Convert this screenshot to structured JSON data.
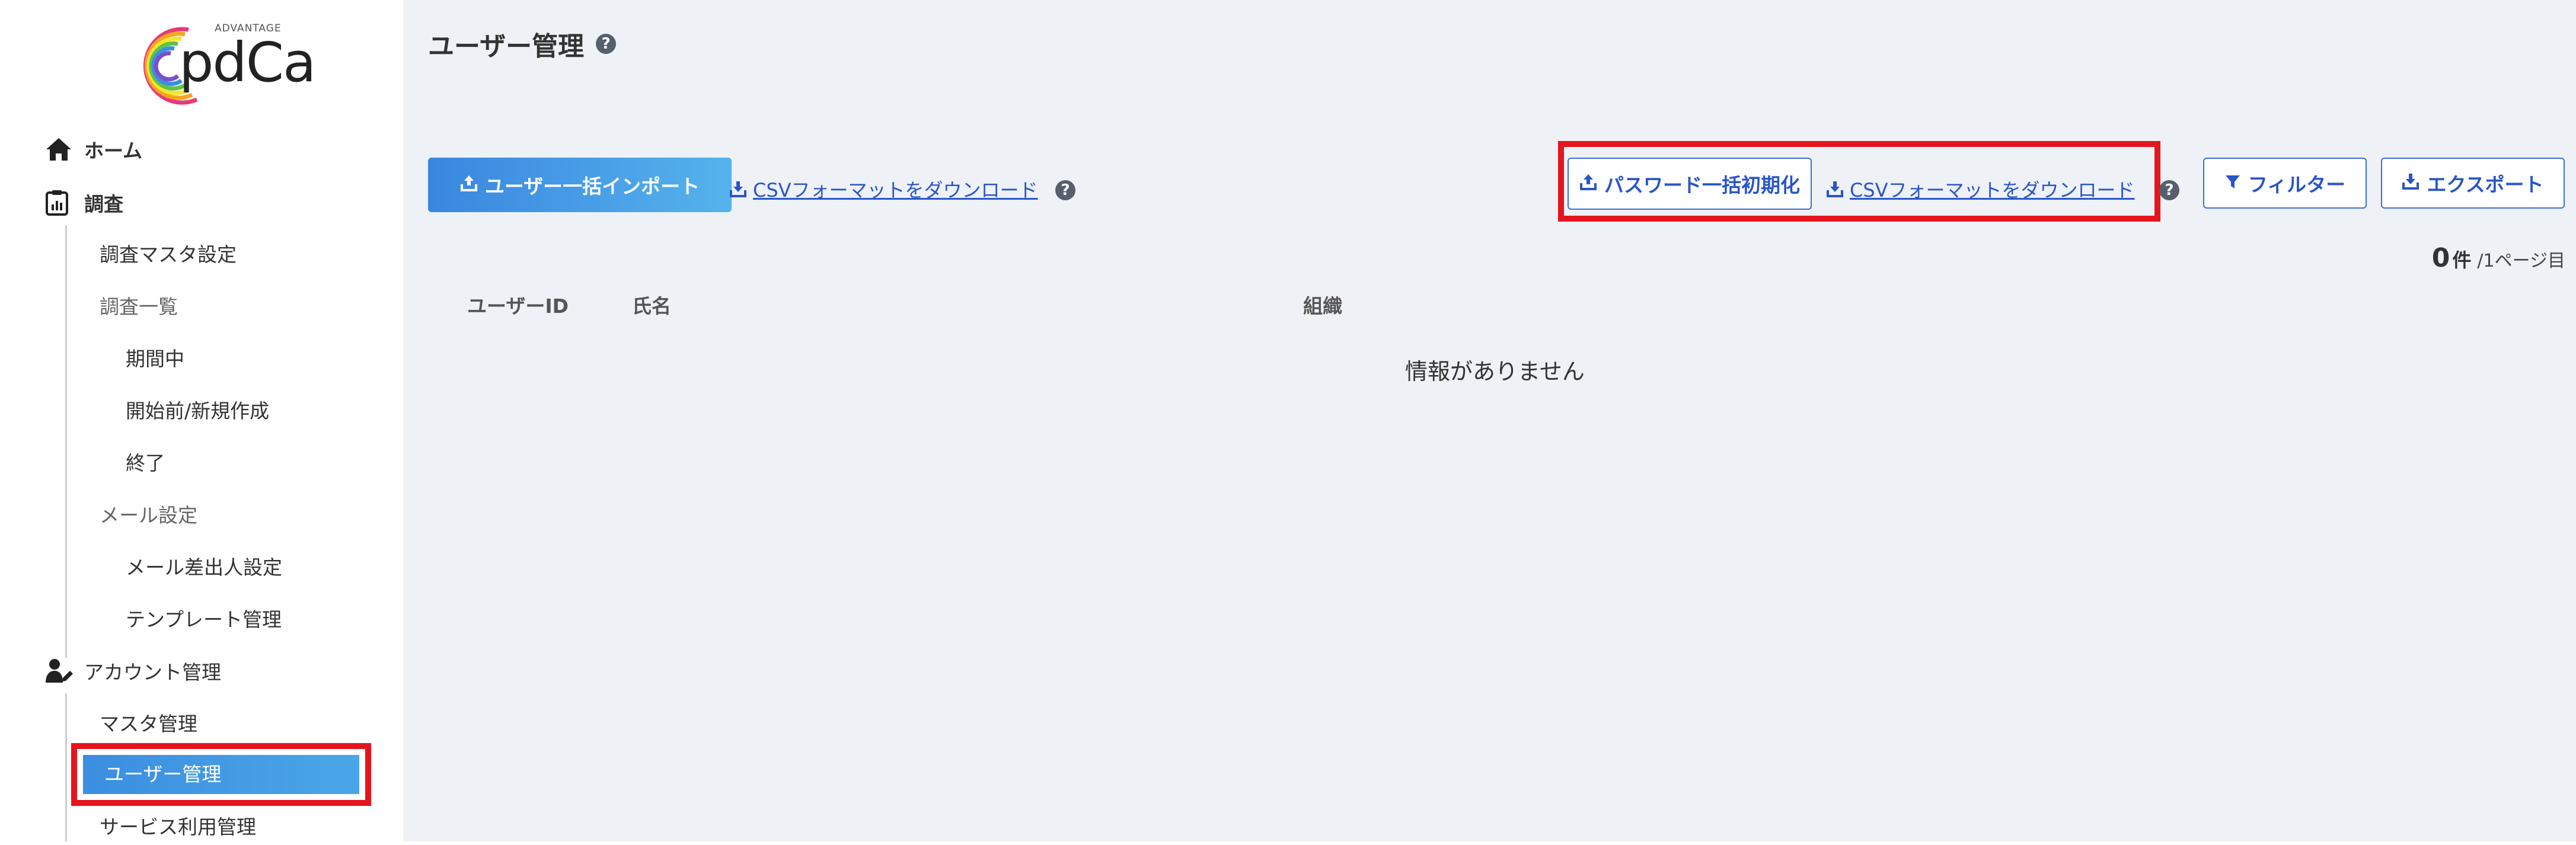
{
  "app": {
    "logo_tagline": "ADVANTAGE",
    "logo_word": "pdCa"
  },
  "sidebar": {
    "home": "ホーム",
    "survey": "調査",
    "survey_master": "調査マスタ設定",
    "survey_list": "調査一覧",
    "in_progress": "期間中",
    "before_start": "開始前/新規作成",
    "ended": "終了",
    "mail_settings": "メール設定",
    "mail_sender": "メール差出人設定",
    "template_mgmt": "テンプレート管理",
    "account_mgmt": "アカウント管理",
    "master_mgmt": "マスタ管理",
    "user_mgmt": "ユーザー管理",
    "service_usage": "サービス利用管理"
  },
  "main": {
    "title": "ユーザー管理",
    "help_symbol": "?",
    "bulk_import_label": "ユーザー一括インポート",
    "csv_download_label": "CSVフォーマットをダウンロード",
    "password_reset_label": "パスワード一括初期化",
    "csv_download_label_2": "CSVフォーマットをダウンロード",
    "filter_label": "フィルター",
    "export_label": "エクスポート",
    "count_number": "0",
    "count_unit": "件",
    "page_info": "/1ページ目",
    "columns": [
      "ユーザーID",
      "氏名",
      "組織"
    ],
    "empty_message": "情報がありません"
  },
  "colors": {
    "accent_blue": "#3c8ee0",
    "link_blue": "#2a55c9",
    "highlight_red": "#e5141d",
    "main_bg": "#eef1f5"
  },
  "icons": {
    "home": "home-icon",
    "survey": "clipboard-chart-icon",
    "account": "user-edit-icon",
    "upload": "upload-icon",
    "download": "download-icon",
    "filter": "filter-icon",
    "help": "question-circle-icon"
  }
}
